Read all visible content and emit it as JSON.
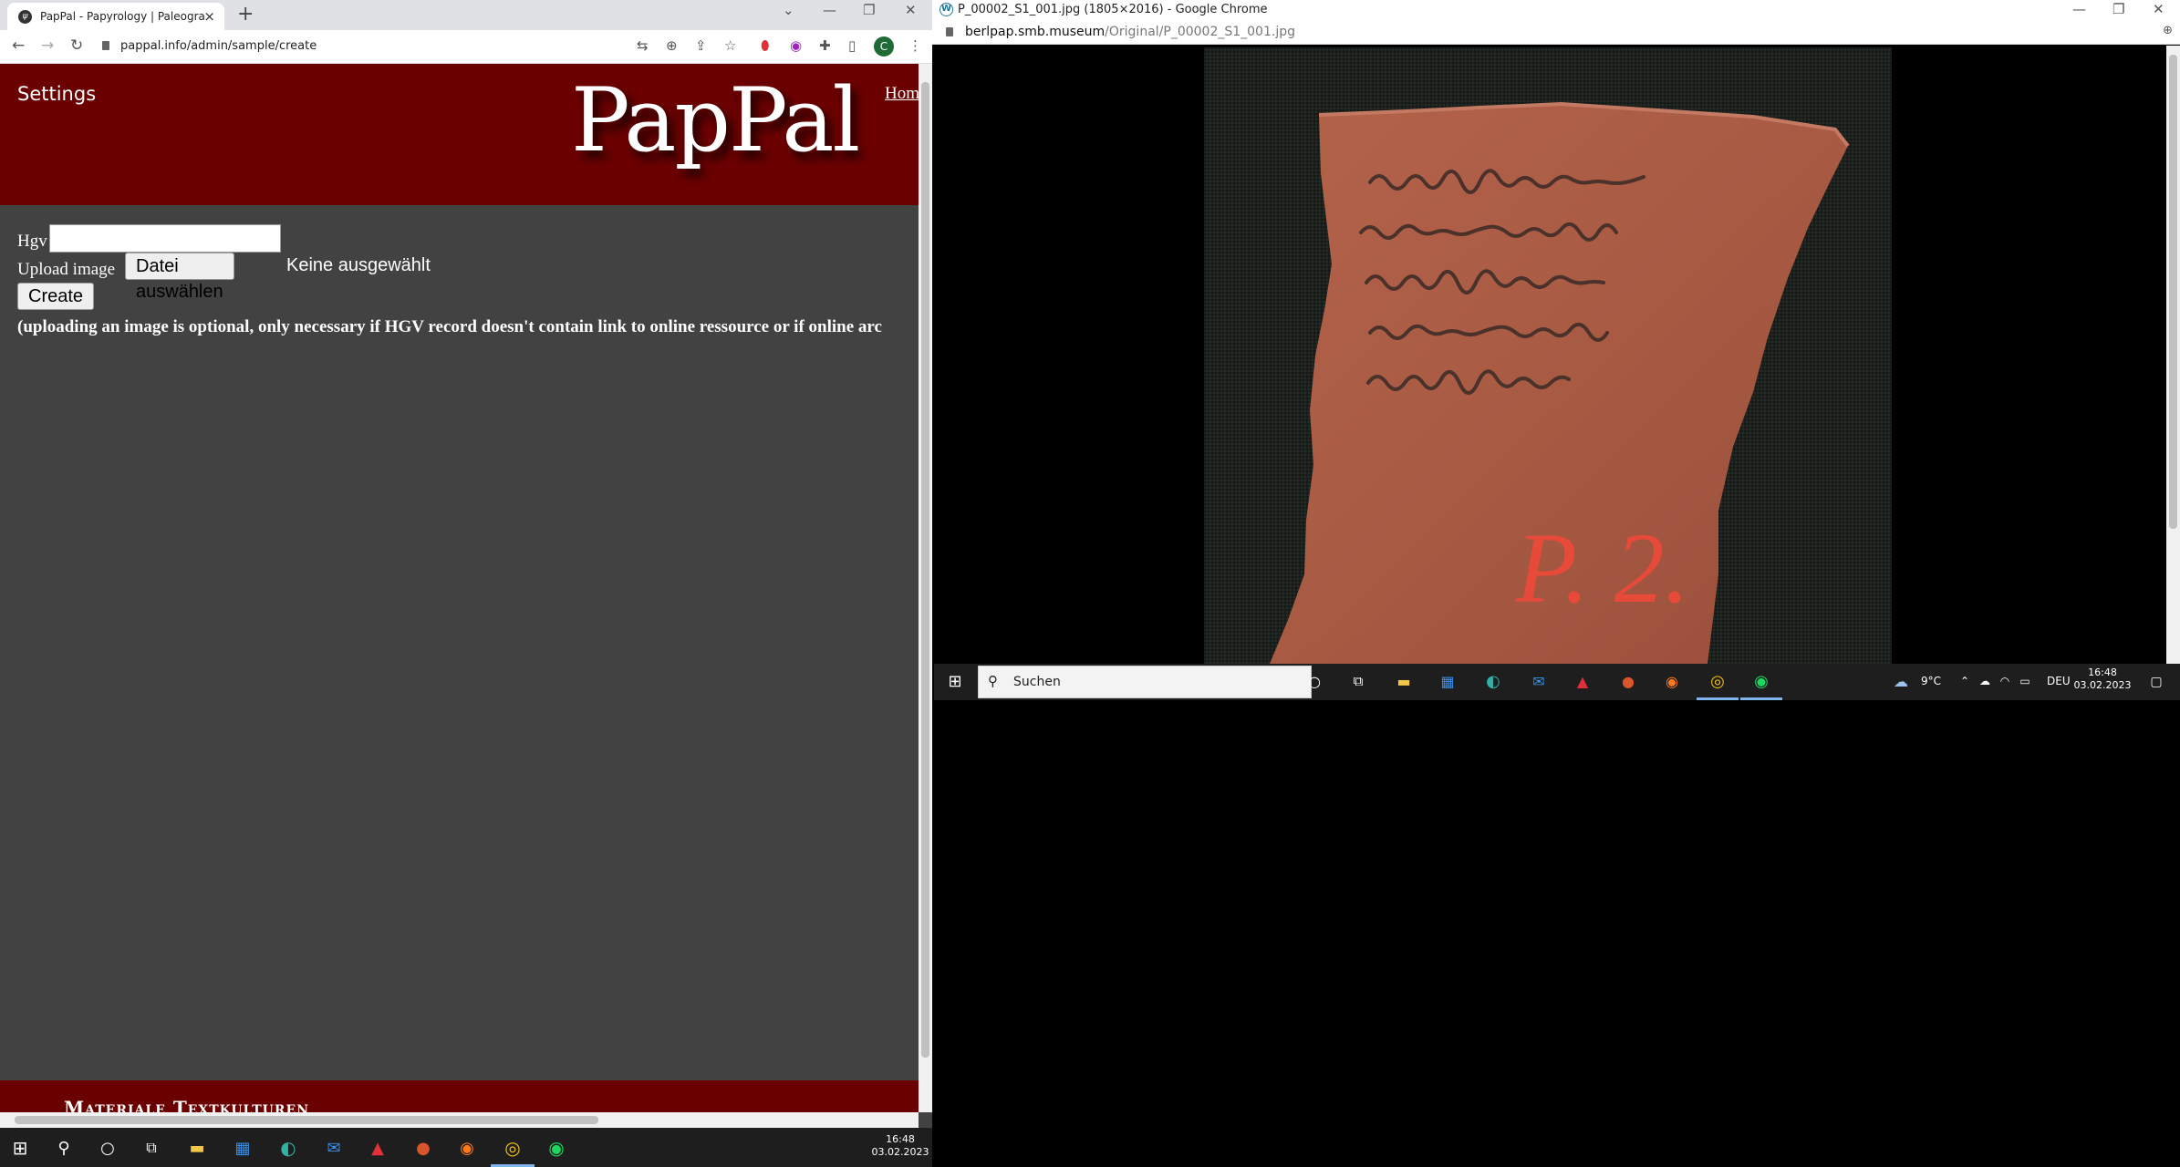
{
  "left_browser": {
    "tab_title": "PapPal - Papyrology | Paleograph",
    "url": "pappal.info/admin/sample/create",
    "profile_initial": "C",
    "page": {
      "settings_link": "Settings",
      "logo": "PapPal",
      "home_link": "Hom",
      "hgv_label": "Hgv",
      "hgv_value": "",
      "upload_label": "Upload image",
      "file_button": "Datei auswählen",
      "file_status": "Keine ausgewählt",
      "create_button": "Create",
      "note": "(uploading an image is optional, only necessary if HGV record doesn't contain link to online ressource or if online arc",
      "footer_text": "Materiale Textkulturen"
    }
  },
  "right_browser": {
    "window_title": "P_00002_S1_001.jpg (1805×2016) - Google Chrome",
    "url_domain": "berlpap.smb.museum",
    "url_path": "/Original/P_00002_S1_001.jpg",
    "image_label": "P. 2."
  },
  "right_taskbar": {
    "search_placeholder": "Suchen",
    "weather": "9°C",
    "language": "DEU",
    "time": "16:48",
    "date": "03.02.2023"
  },
  "left_taskbar": {
    "time": "16:48",
    "date": "03.02.2023"
  },
  "colors": {
    "header_red": "#6b0000",
    "page_gray": "#424242",
    "taskbar": "#1e1e1e",
    "sherd": "#a85a43"
  }
}
